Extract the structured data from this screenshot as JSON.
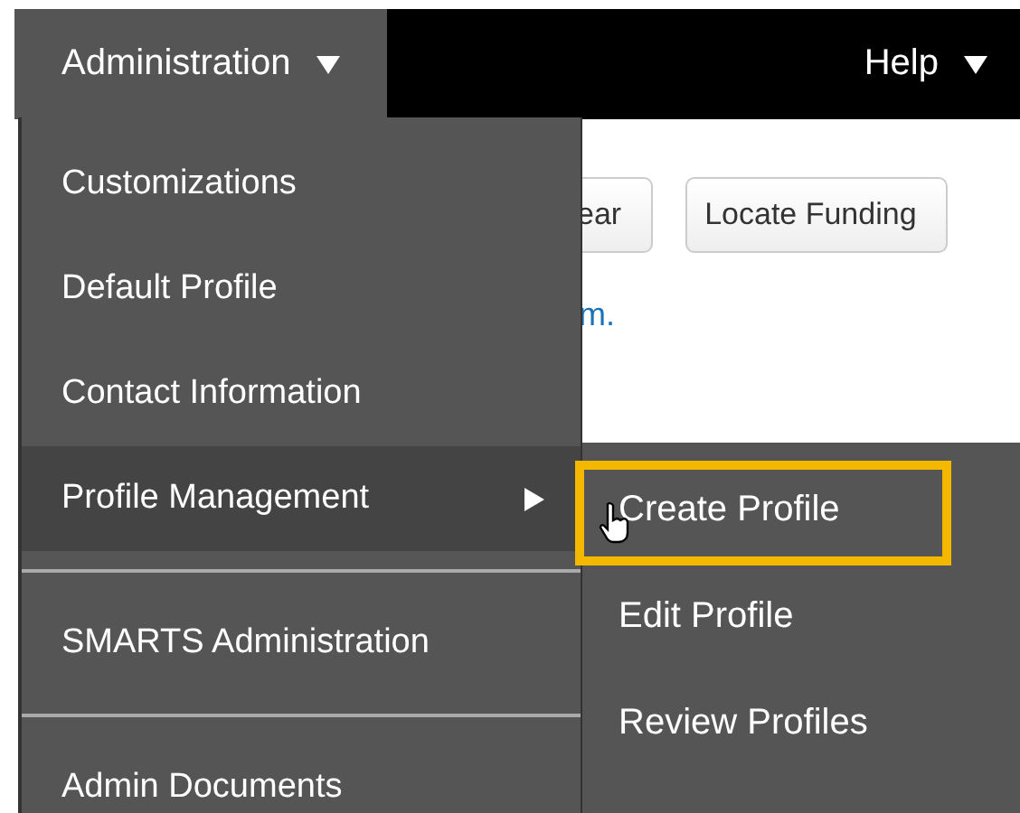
{
  "nav": {
    "items": [
      {
        "label": "Administration",
        "selected": true
      },
      {
        "label": "Help",
        "selected": false
      }
    ]
  },
  "content": {
    "buttons": [
      "ear",
      "Locate Funding"
    ],
    "link": "m."
  },
  "menu": {
    "items": [
      {
        "kind": "item",
        "label": "Customizations",
        "selected": false
      },
      {
        "kind": "item",
        "label": "Default Profile",
        "selected": false
      },
      {
        "kind": "item",
        "label": "Contact Information",
        "selected": false
      },
      {
        "kind": "submenu",
        "label": "Profile Management",
        "selected": true
      },
      {
        "kind": "divider"
      },
      {
        "kind": "item",
        "label": "SMARTS Administration",
        "selected": false
      },
      {
        "kind": "divider"
      },
      {
        "kind": "item",
        "label": "Admin Documents",
        "selected": false
      }
    ]
  },
  "submenu": {
    "items": [
      {
        "label": "Create Profile",
        "highlighted": true
      },
      {
        "label": "Edit Profile",
        "highlighted": false
      },
      {
        "label": "Review Profiles",
        "highlighted": false
      }
    ]
  }
}
